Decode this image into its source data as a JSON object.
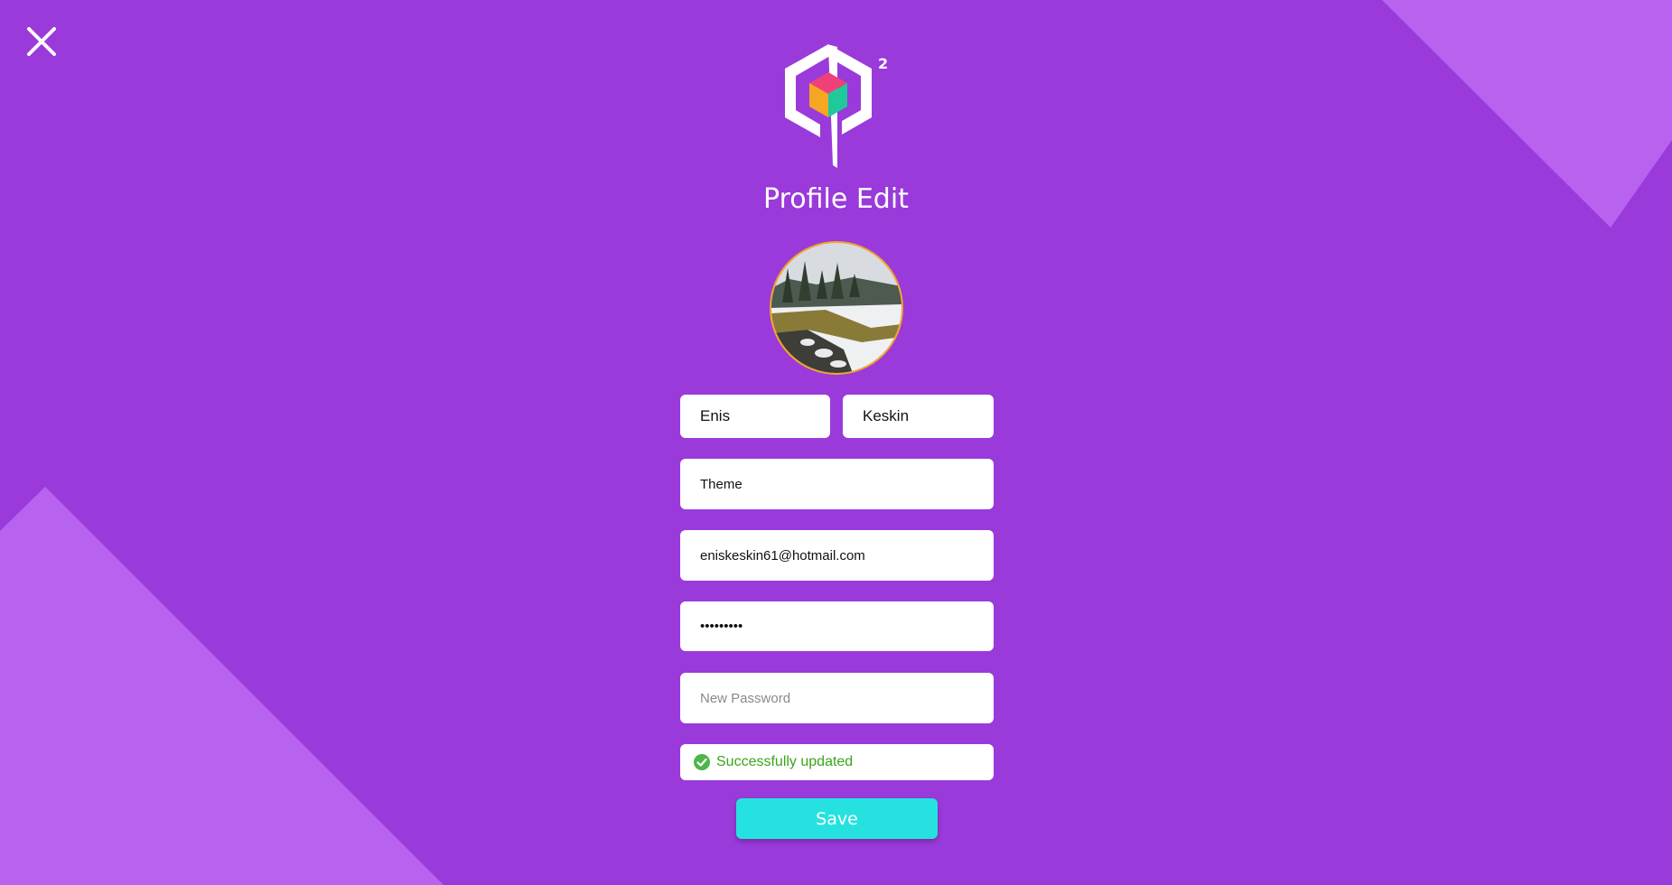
{
  "page": {
    "title": "Profile Edit",
    "background_color": "#9a3adb",
    "accent_color": "#25e2e0",
    "decor_color": "#b763f0"
  },
  "header": {
    "close_icon": "close-icon",
    "logo_icon": "q-squared-cube-logo",
    "logo_superscript": "2"
  },
  "avatar": {
    "image": "snowy-landscape-photo",
    "border_color": "#f5a623"
  },
  "form": {
    "first_name": {
      "value": "Enis"
    },
    "last_name": {
      "value": "Keskin"
    },
    "theme": {
      "value": "Theme"
    },
    "email": {
      "value": "eniskeskin61@hotmail.com"
    },
    "password": {
      "value": "•••••••••"
    },
    "new_password": {
      "placeholder": "New Password",
      "value": ""
    }
  },
  "status": {
    "icon": "check-circle-icon",
    "text": "Successfully updated",
    "color": "#3aa51b"
  },
  "actions": {
    "save_label": "Save"
  }
}
